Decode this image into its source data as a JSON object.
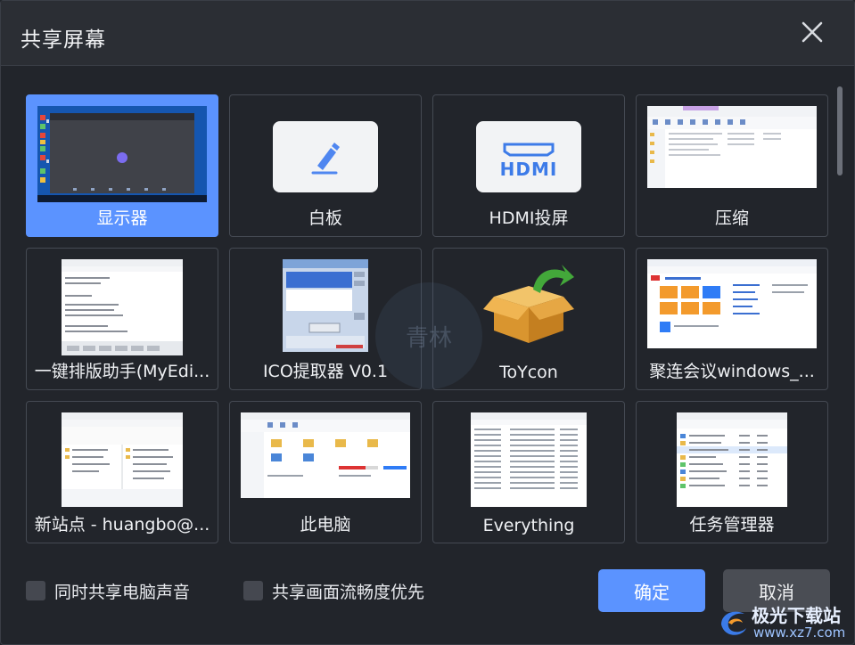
{
  "dialog": {
    "title": "共享屏幕"
  },
  "tiles": [
    {
      "label": "显示器",
      "selected": true
    },
    {
      "label": "白板"
    },
    {
      "label": "HDMI投屏",
      "hdmi_text": "HDMI"
    },
    {
      "label": "压缩"
    },
    {
      "label": "一键排版助手(MyEdi..."
    },
    {
      "label": "ICO提取器 V0.1"
    },
    {
      "label": "ToYcon"
    },
    {
      "label": "聚连会议windows_..."
    },
    {
      "label": "新站点 - huangbo@..."
    },
    {
      "label": "此电脑"
    },
    {
      "label": "Everything"
    },
    {
      "label": "任务管理器"
    }
  ],
  "options": {
    "share_audio": "同时共享电脑声音",
    "smooth_priority": "共享画面流畅度优先"
  },
  "buttons": {
    "ok": "确定",
    "cancel": "取消"
  },
  "watermark": {
    "center": "青林",
    "brand": "极光下载站",
    "url": "www.xz7.com"
  },
  "colors": {
    "accent": "#5b93ff",
    "background": "#22252b",
    "tile_border": "#454a53"
  }
}
